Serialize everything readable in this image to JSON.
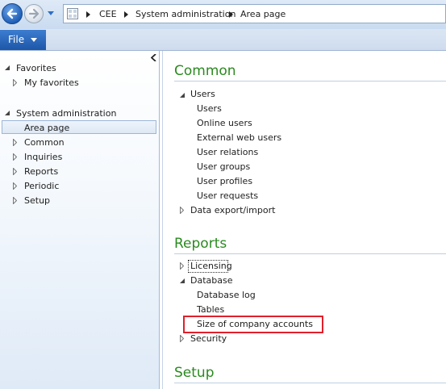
{
  "address_bar": {
    "breadcrumbs": [
      "CEE",
      "System administration",
      "Area page"
    ]
  },
  "menu": {
    "file_label": "File"
  },
  "nav": {
    "favorites_label": "Favorites",
    "my_favorites_label": "My favorites",
    "module_label": "System administration",
    "items": [
      "Area page",
      "Common",
      "Inquiries",
      "Reports",
      "Periodic",
      "Setup"
    ],
    "selected": "Area page"
  },
  "content": {
    "common": {
      "title": "Common",
      "users_group": "Users",
      "users_links": [
        "Users",
        "Online users",
        "External web users",
        "User relations",
        "User groups",
        "User profiles",
        "User requests"
      ],
      "data_export_import": "Data export/import"
    },
    "reports": {
      "title": "Reports",
      "licensing": "Licensing",
      "database_group": "Database",
      "database_links": [
        "Database log",
        "Tables",
        "Size of company accounts"
      ],
      "security": "Security"
    },
    "setup": {
      "title": "Setup"
    }
  },
  "annotation": {
    "highlighted_item": "Size of company accounts",
    "highlight_color": "#e0202a"
  },
  "colors": {
    "section_title": "#2a8a1f",
    "file_button": "#1d56a8"
  }
}
